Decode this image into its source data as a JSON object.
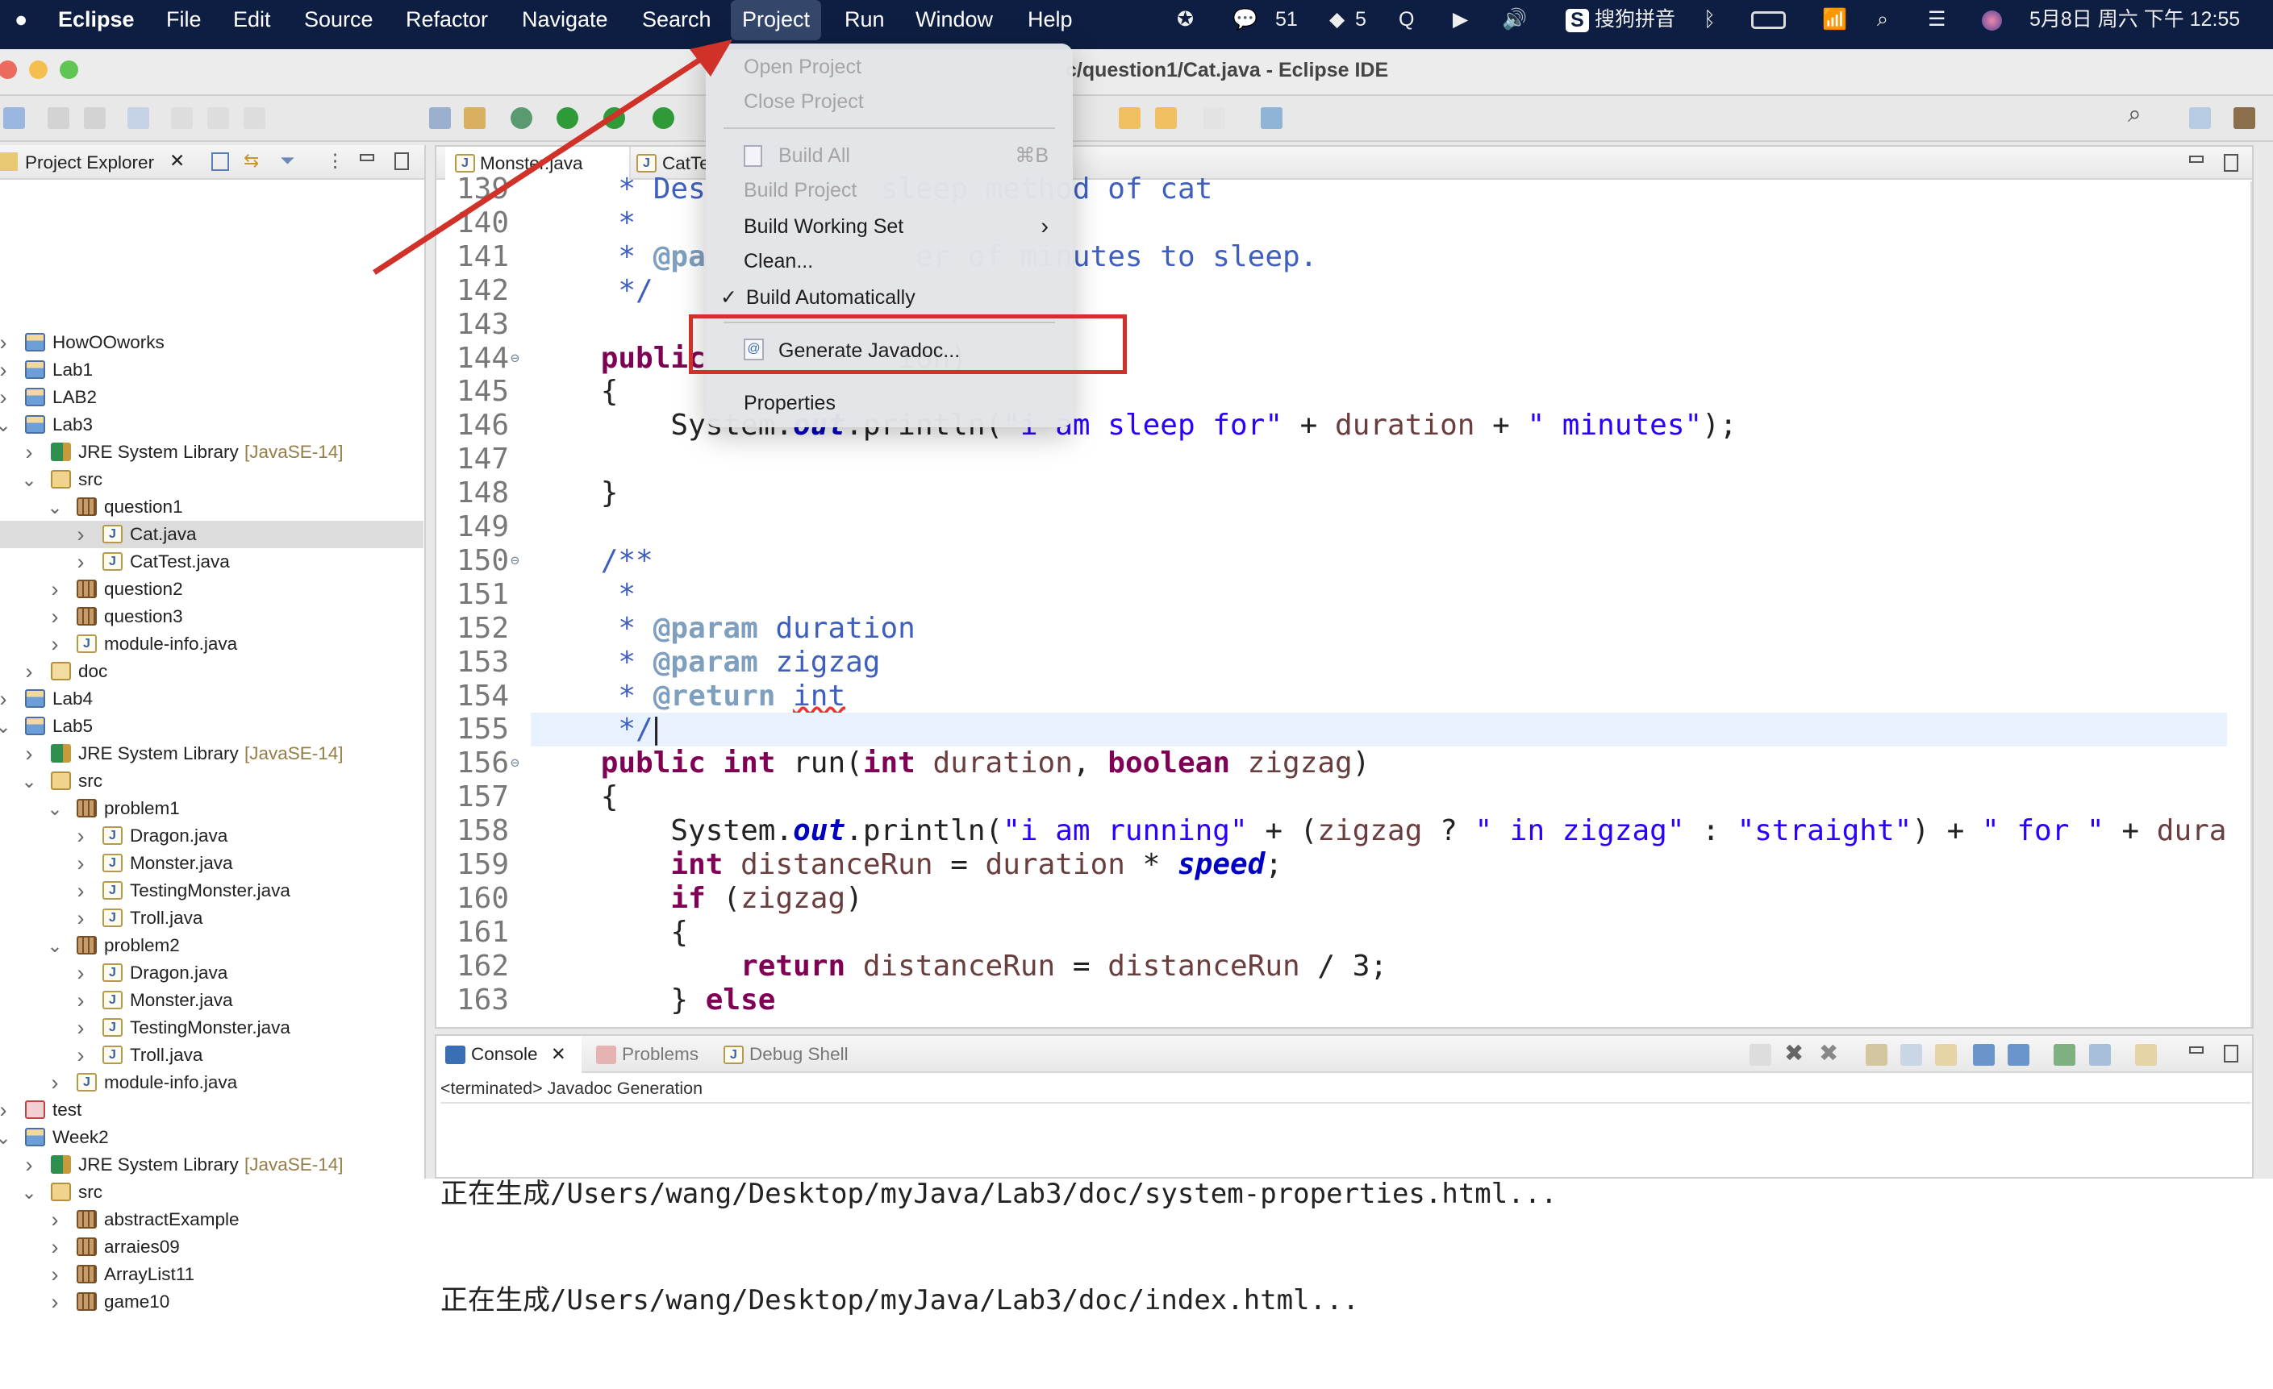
{
  "menubar": {
    "app": "Eclipse",
    "items": [
      "File",
      "Edit",
      "Source",
      "Refactor",
      "Navigate",
      "Search",
      "Project",
      "Run",
      "Window",
      "Help"
    ],
    "active": "Project",
    "status": {
      "wechat_count": "51",
      "msg_count": "5",
      "input_method": "搜狗拼音",
      "datetime": "5月8日 周六 下午 12:55"
    }
  },
  "window": {
    "title": "c/question1/Cat.java - Eclipse IDE"
  },
  "explorer": {
    "title": "Project Explorer",
    "tree": [
      {
        "label": "HowOOworks",
        "level": 0,
        "icon": "project",
        "state": "closed"
      },
      {
        "label": "Lab1",
        "level": 0,
        "icon": "project",
        "state": "closed"
      },
      {
        "label": "LAB2",
        "level": 0,
        "icon": "project",
        "state": "closed"
      },
      {
        "label": "Lab3",
        "level": 0,
        "icon": "project",
        "state": "open"
      },
      {
        "label": "JRE System Library",
        "decoration": "[JavaSE-14]",
        "level": 1,
        "icon": "library",
        "state": "closed"
      },
      {
        "label": "src",
        "level": 1,
        "icon": "source-folder",
        "state": "open"
      },
      {
        "label": "question1",
        "level": 2,
        "icon": "package",
        "state": "open"
      },
      {
        "label": "Cat.java",
        "level": 3,
        "icon": "java-file",
        "state": "closed",
        "selected": true
      },
      {
        "label": "CatTest.java",
        "level": 3,
        "icon": "java-file",
        "state": "closed"
      },
      {
        "label": "question2",
        "level": 2,
        "icon": "package",
        "state": "closed"
      },
      {
        "label": "question3",
        "level": 2,
        "icon": "package",
        "state": "closed"
      },
      {
        "label": "module-info.java",
        "level": 2,
        "icon": "java-file",
        "state": "closed"
      },
      {
        "label": "doc",
        "level": 1,
        "icon": "folder",
        "state": "closed"
      },
      {
        "label": "Lab4",
        "level": 0,
        "icon": "project",
        "state": "closed"
      },
      {
        "label": "Lab5",
        "level": 0,
        "icon": "project",
        "state": "open"
      },
      {
        "label": "JRE System Library",
        "decoration": "[JavaSE-14]",
        "level": 1,
        "icon": "library",
        "state": "closed"
      },
      {
        "label": "src",
        "level": 1,
        "icon": "source-folder",
        "state": "open"
      },
      {
        "label": "problem1",
        "level": 2,
        "icon": "package",
        "state": "open"
      },
      {
        "label": "Dragon.java",
        "level": 3,
        "icon": "java-file",
        "state": "closed"
      },
      {
        "label": "Monster.java",
        "level": 3,
        "icon": "java-file",
        "state": "closed"
      },
      {
        "label": "TestingMonster.java",
        "level": 3,
        "icon": "java-file",
        "state": "closed"
      },
      {
        "label": "Troll.java",
        "level": 3,
        "icon": "java-file",
        "state": "closed"
      },
      {
        "label": "problem2",
        "level": 2,
        "icon": "package",
        "state": "open"
      },
      {
        "label": "Dragon.java",
        "level": 3,
        "icon": "java-file",
        "state": "closed"
      },
      {
        "label": "Monster.java",
        "level": 3,
        "icon": "java-file",
        "state": "closed"
      },
      {
        "label": "TestingMonster.java",
        "level": 3,
        "icon": "java-file",
        "state": "closed"
      },
      {
        "label": "Troll.java",
        "level": 3,
        "icon": "java-file",
        "state": "closed"
      },
      {
        "label": "module-info.java",
        "level": 2,
        "icon": "java-file",
        "state": "closed"
      },
      {
        "label": "test",
        "level": 0,
        "icon": "test-project",
        "state": "closed"
      },
      {
        "label": "Week2",
        "level": 0,
        "icon": "project",
        "state": "open"
      },
      {
        "label": "JRE System Library",
        "decoration": "[JavaSE-14]",
        "level": 1,
        "icon": "library",
        "state": "closed"
      },
      {
        "label": "src",
        "level": 1,
        "icon": "source-folder",
        "state": "open"
      },
      {
        "label": "abstractExample",
        "level": 2,
        "icon": "package",
        "state": "closed"
      },
      {
        "label": "arraies09",
        "level": 2,
        "icon": "package",
        "state": "closed"
      },
      {
        "label": "ArrayList11",
        "level": 2,
        "icon": "package",
        "state": "closed"
      },
      {
        "label": "game10",
        "level": 2,
        "icon": "package",
        "state": "closed"
      }
    ]
  },
  "editor": {
    "tabs": [
      "Monster.java",
      "CatTe"
    ],
    "current_line": "155",
    "lines": [
      {
        "n": "139",
        "t": [
          [
            "cm",
            "     * Des"
          ],
          [
            "",
            "          "
          ],
          [
            "cm",
            "sleep method of cat"
          ]
        ]
      },
      {
        "n": "140",
        "t": [
          [
            "cm",
            "     *"
          ]
        ]
      },
      {
        "n": "141",
        "t": [
          [
            "cm",
            "     * "
          ],
          [
            "tag",
            "@pa"
          ],
          [
            "cm",
            "            er of minutes to sleep."
          ]
        ]
      },
      {
        "n": "142",
        "t": [
          [
            "cm",
            "     */"
          ]
        ]
      },
      {
        "n": "143",
        "t": []
      },
      {
        "n": "144",
        "t": [
          [
            "kw",
            "    public"
          ],
          [
            "",
            "           "
          ],
          [
            "var",
            "ion"
          ],
          [
            "",
            ")"
          ]
        ]
      },
      {
        "n": "145",
        "t": [
          [
            "",
            "    {"
          ]
        ]
      },
      {
        "n": "146",
        "t": [
          [
            "",
            "        System."
          ],
          [
            "fld",
            "out"
          ],
          [
            "",
            ".println("
          ],
          [
            "str",
            "\"i am sleep for\""
          ],
          [
            "",
            " + "
          ],
          [
            "var",
            "duration"
          ],
          [
            "",
            " + "
          ],
          [
            "str",
            "\" minutes\""
          ],
          [
            "",
            ");"
          ]
        ]
      },
      {
        "n": "147",
        "t": []
      },
      {
        "n": "148",
        "t": [
          [
            "",
            "    }"
          ]
        ]
      },
      {
        "n": "149",
        "t": []
      },
      {
        "n": "150",
        "t": [
          [
            "cm",
            "    /**"
          ]
        ]
      },
      {
        "n": "151",
        "t": [
          [
            "cm",
            "     *"
          ]
        ]
      },
      {
        "n": "152",
        "t": [
          [
            "cm",
            "     * "
          ],
          [
            "tag",
            "@param"
          ],
          [
            "cm",
            " duration"
          ]
        ]
      },
      {
        "n": "153",
        "t": [
          [
            "cm",
            "     * "
          ],
          [
            "tag",
            "@param"
          ],
          [
            "cm",
            " zigzag"
          ]
        ]
      },
      {
        "n": "154",
        "t": [
          [
            "cm",
            "     * "
          ],
          [
            "tag",
            "@return"
          ],
          [
            "cm",
            " "
          ],
          [
            "sq",
            "int"
          ]
        ]
      },
      {
        "n": "155",
        "t": [
          [
            "cm",
            "     */"
          ]
        ]
      },
      {
        "n": "156",
        "t": [
          [
            "kw",
            "    public int"
          ],
          [
            "",
            " run("
          ],
          [
            "kw",
            "int"
          ],
          [
            "var",
            " duration"
          ],
          [
            ", "
          ],
          [
            "kw",
            "boolean"
          ],
          [
            "var",
            " zigzag"
          ],
          [
            "",
            ")"
          ]
        ]
      },
      {
        "n": "157",
        "t": [
          [
            "",
            "    {"
          ]
        ]
      },
      {
        "n": "158",
        "t": [
          [
            "",
            "        System."
          ],
          [
            "fld",
            "out"
          ],
          [
            "",
            ".println("
          ],
          [
            "str",
            "\"i am running\""
          ],
          [
            "",
            " + ("
          ],
          [
            "var",
            "zigzag"
          ],
          [
            "",
            " ? "
          ],
          [
            "str",
            "\" in zigzag\""
          ],
          [
            "",
            " : "
          ],
          [
            "str",
            "\"straight\""
          ],
          [
            "",
            ") + "
          ],
          [
            "str",
            "\" for \""
          ],
          [
            "",
            " + "
          ],
          [
            "var",
            "duration"
          ]
        ]
      },
      {
        "n": "159",
        "t": [
          [
            "kw",
            "        int"
          ],
          [
            "var",
            " distanceRun"
          ],
          [
            "",
            " = "
          ],
          [
            "var",
            "duration"
          ],
          [
            "",
            " * "
          ],
          [
            "fld",
            "speed"
          ],
          [
            "",
            ";"
          ]
        ]
      },
      {
        "n": "160",
        "t": [
          [
            "kw",
            "        if"
          ],
          [
            "",
            " ("
          ],
          [
            "var",
            "zigzag"
          ],
          [
            "",
            ")"
          ]
        ]
      },
      {
        "n": "161",
        "t": [
          [
            "",
            "        {"
          ]
        ]
      },
      {
        "n": "162",
        "t": [
          [
            "kw",
            "            return"
          ],
          [
            "var",
            " distanceRun"
          ],
          [
            "",
            " = "
          ],
          [
            "var",
            "distanceRun"
          ],
          [
            "",
            " / 3;"
          ]
        ]
      },
      {
        "n": "163",
        "t": [
          [
            "",
            "        } "
          ],
          [
            "kw",
            "else"
          ]
        ]
      }
    ]
  },
  "project_menu": {
    "items": [
      {
        "label": "Open Project",
        "enabled": false
      },
      {
        "label": "Close Project",
        "enabled": false
      },
      {
        "label": "Build All",
        "shortcut": "⌘B",
        "enabled": false
      },
      {
        "label": "Build Project",
        "enabled": false
      },
      {
        "label": "Build Working Set",
        "submenu": true,
        "enabled": true
      },
      {
        "label": "Clean...",
        "enabled": true
      },
      {
        "label": "Build Automatically",
        "checked": true,
        "enabled": true
      },
      {
        "label": "Generate Javadoc...",
        "enabled": true,
        "highlighted_annotation": true
      },
      {
        "label": "Properties",
        "enabled": true
      }
    ]
  },
  "console": {
    "tabs": [
      "Console",
      "Problems",
      "Debug Shell"
    ],
    "status": "<terminated> Javadoc Generation",
    "output": [
      "正在生成/Users/wang/Desktop/myJava/Lab3/doc/system-properties.html...",
      "正在生成/Users/wang/Desktop/myJava/Lab3/doc/index.html..."
    ]
  },
  "colors": {
    "annotation": "#d0322a",
    "menubar": "#0d1e42",
    "selection": "#dcdcdc",
    "current_line": "#e8f2fe"
  }
}
